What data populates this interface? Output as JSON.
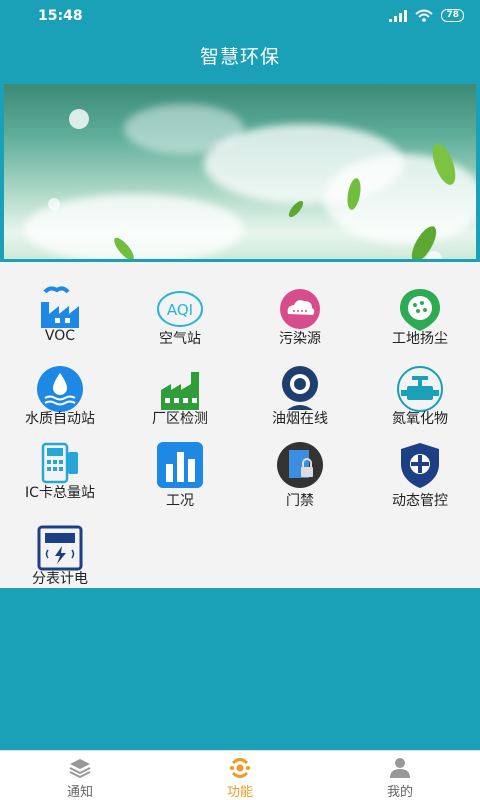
{
  "status_bar": {
    "time": "15:48",
    "battery": "78"
  },
  "header": {
    "title": "智慧环保"
  },
  "functions": [
    {
      "label": "VOC",
      "icon": "factory-icon"
    },
    {
      "label": "空气站",
      "icon": "aqi-icon"
    },
    {
      "label": "污染源",
      "icon": "cloud-icon"
    },
    {
      "label": "工地扬尘",
      "icon": "dust-icon"
    },
    {
      "label": "水质自动站",
      "icon": "water-drop-icon"
    },
    {
      "label": "厂区检测",
      "icon": "plant-icon"
    },
    {
      "label": "油烟在线",
      "icon": "camera-icon"
    },
    {
      "label": "氮氧化物",
      "icon": "valve-icon"
    },
    {
      "label": "IC卡总量站",
      "icon": "card-reader-icon"
    },
    {
      "label": "工况",
      "icon": "bar-chart-icon"
    },
    {
      "label": "门禁",
      "icon": "door-lock-icon"
    },
    {
      "label": "动态管控",
      "icon": "shield-icon"
    },
    {
      "label": "分表计电",
      "icon": "power-meter-icon"
    }
  ],
  "aqi_icon_text": "AQI",
  "bottom_nav": [
    {
      "label": "通知",
      "icon": "stack-icon",
      "active": false
    },
    {
      "label": "功能",
      "icon": "function-icon",
      "active": true
    },
    {
      "label": "我的",
      "icon": "user-icon",
      "active": false
    }
  ],
  "colors": {
    "primary": "#1aa1b8",
    "active": "#f39a22"
  }
}
